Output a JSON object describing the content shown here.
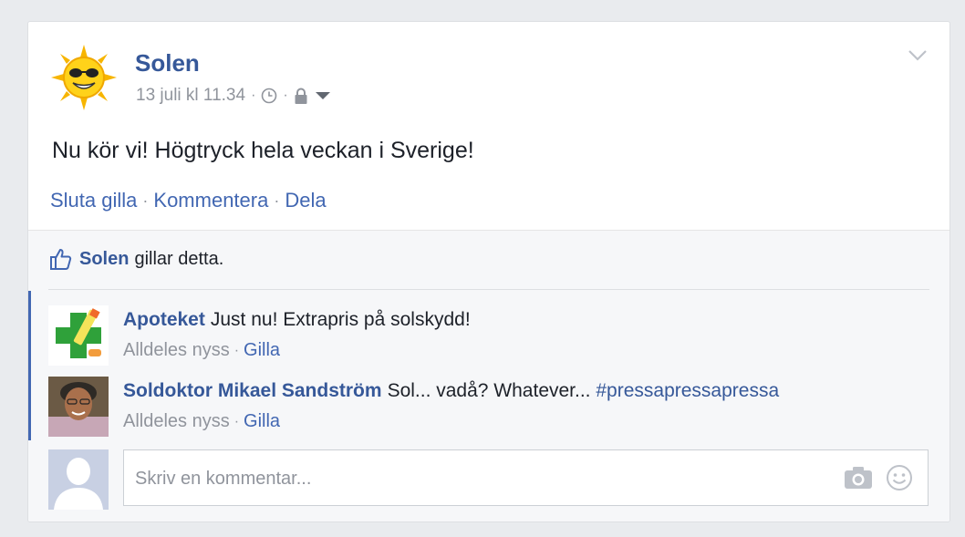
{
  "post": {
    "author": "Solen",
    "timestamp": "13 juli kl 11.34",
    "meta_icons": [
      "clock-icon",
      "lock-icon",
      "caret-down-icon"
    ],
    "text": "Nu kör vi! Högtryck hela veckan i Sverige!",
    "actions": {
      "unlike": "Sluta gilla",
      "comment": "Kommentera",
      "share": "Dela"
    }
  },
  "likes": {
    "liker": "Solen",
    "suffix": "gillar detta."
  },
  "comments": [
    {
      "author": "Apoteket",
      "text": "Just nu! Extrapris på solskydd!",
      "hashtag": "",
      "time": "Alldeles nyss",
      "like_label": "Gilla"
    },
    {
      "author": "Soldoktor Mikael Sandström",
      "text": "Sol... vadå? Whatever...",
      "hashtag": "#pressapressapressa",
      "time": "Alldeles nyss",
      "like_label": "Gilla"
    }
  ],
  "compose": {
    "placeholder": "Skriv en kommentar...",
    "value": ""
  },
  "colors": {
    "link": "#365899",
    "action": "#4267b2",
    "muted": "#90949c",
    "background": "#e9ebee"
  }
}
